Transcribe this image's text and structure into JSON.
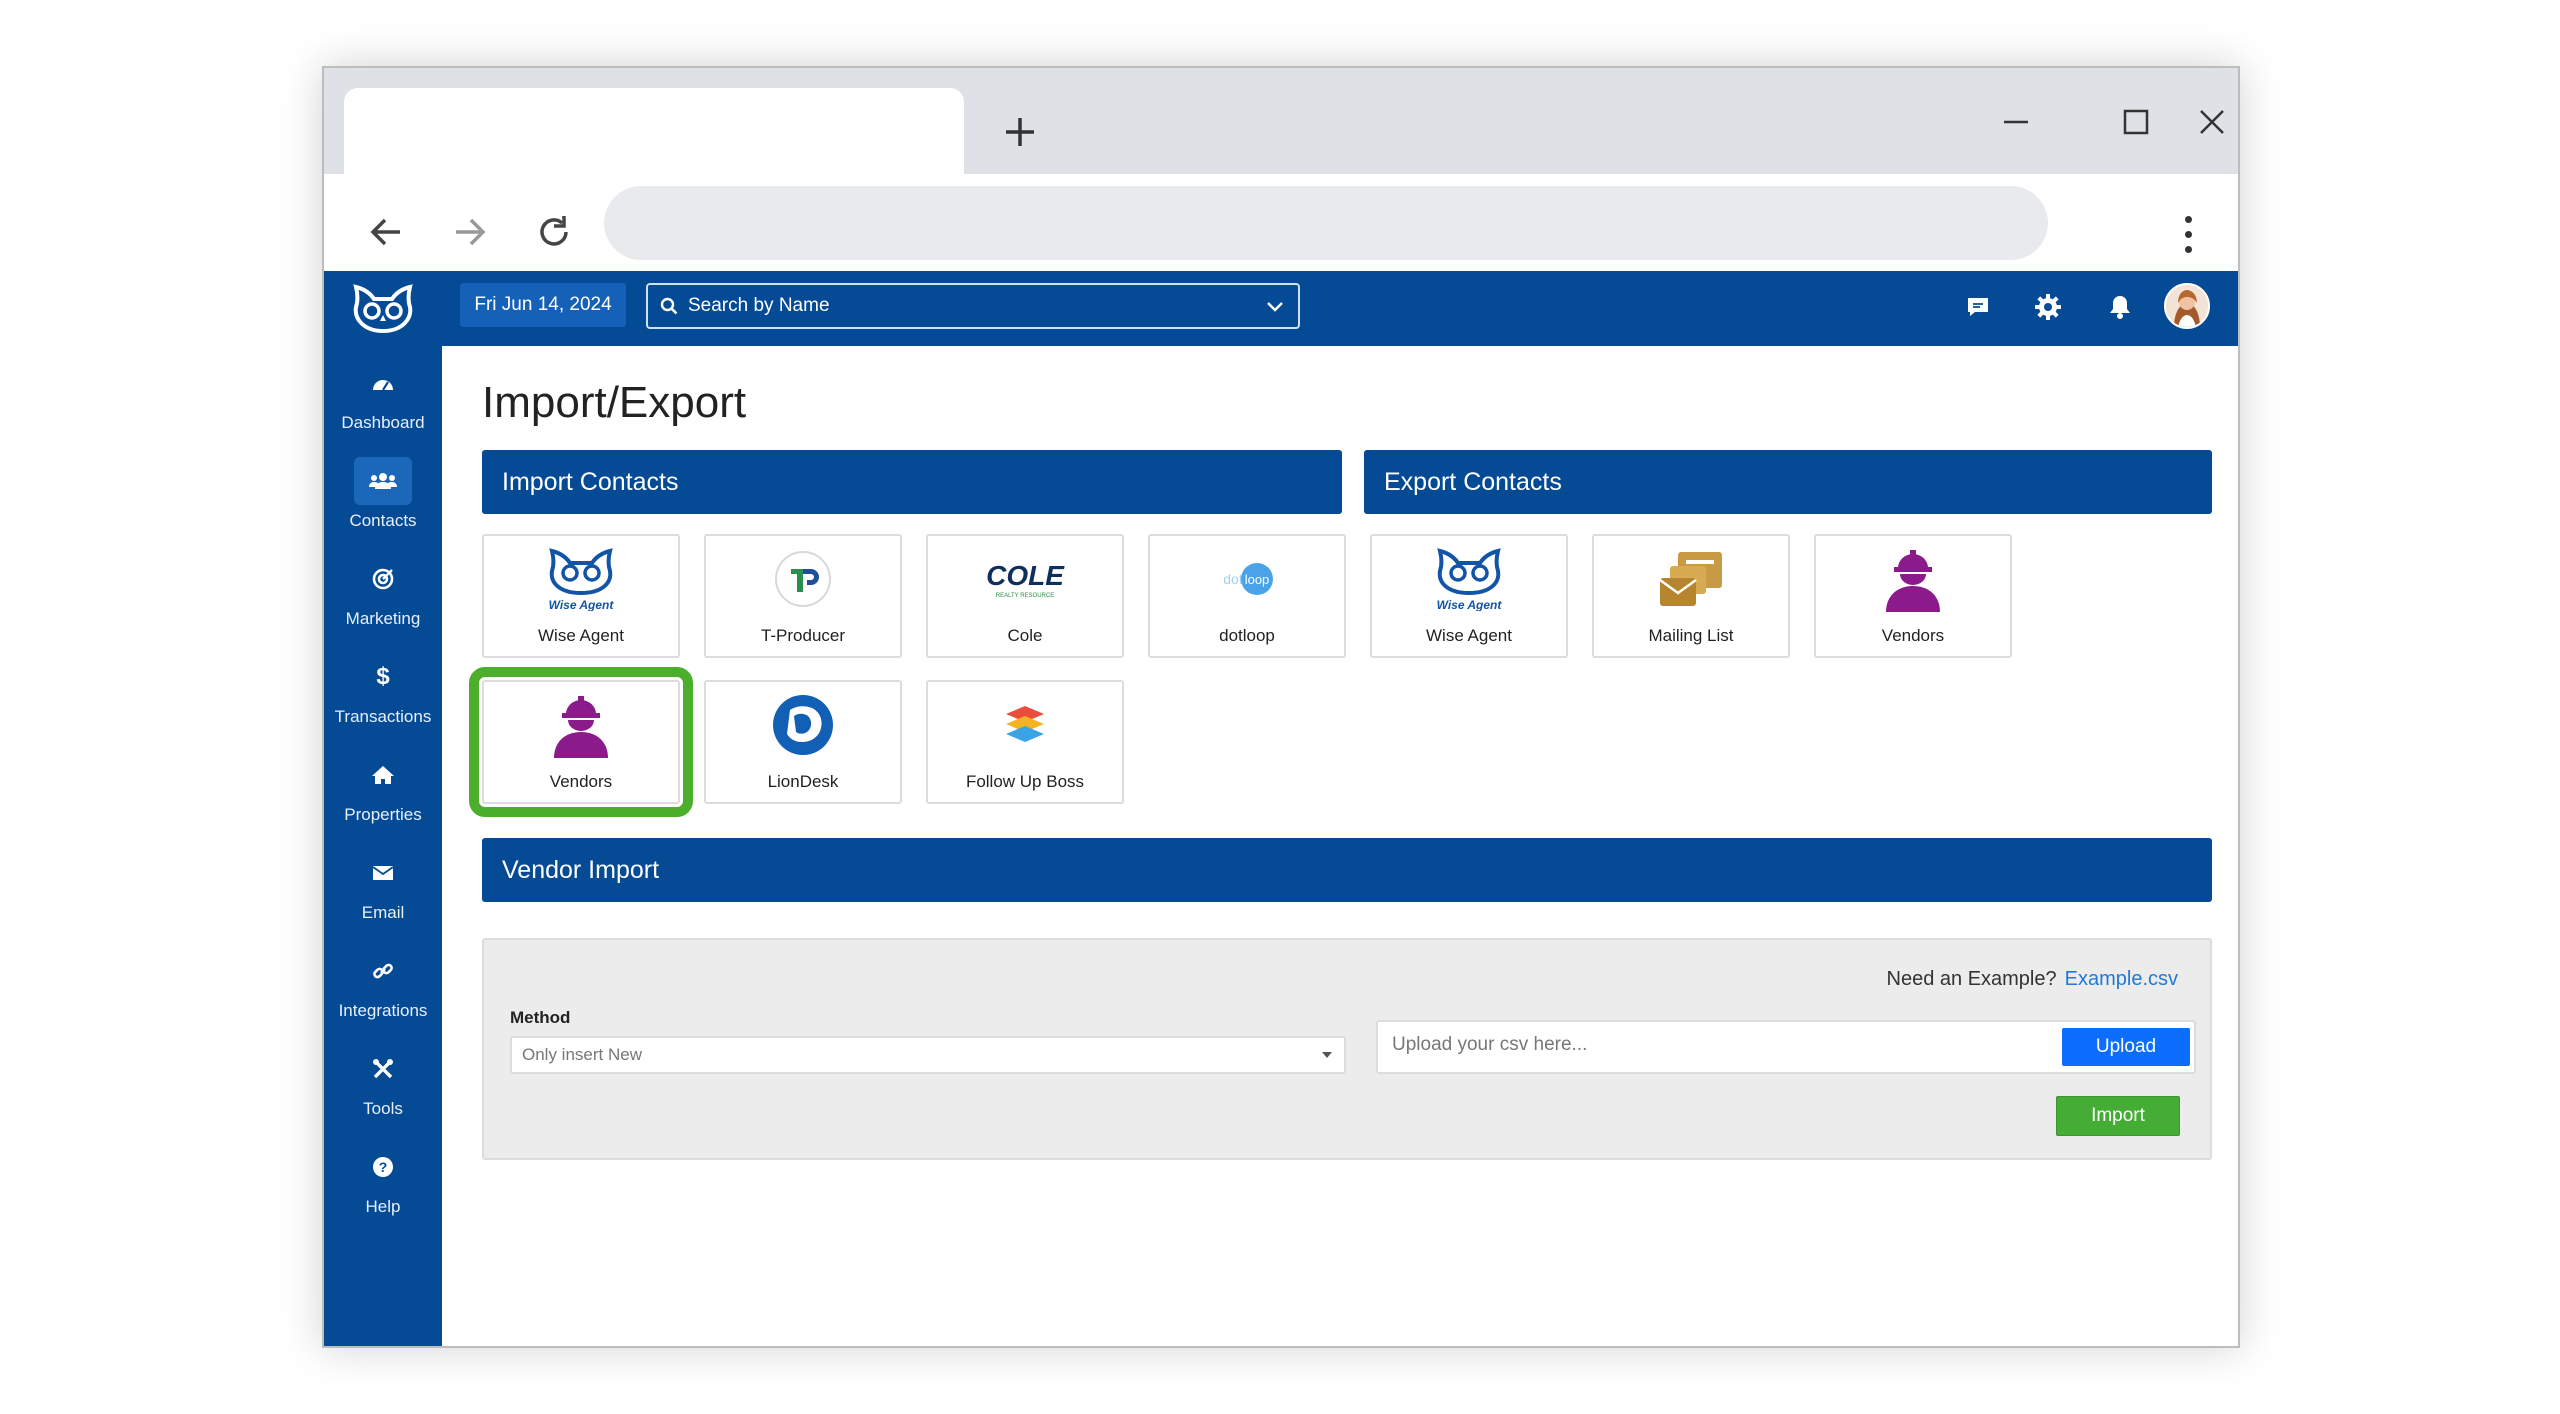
{
  "browser": {
    "new_tab_icon": "plus-icon",
    "window_controls": [
      "minimize-icon",
      "maximize-icon",
      "close-icon"
    ],
    "nav": [
      "back-arrow-icon",
      "forward-arrow-icon",
      "reload-icon"
    ],
    "menu_icon": "kebab-menu-icon"
  },
  "app": {
    "date": "Fri Jun 14, 2024",
    "search": {
      "placeholder": "Search by Name"
    },
    "sidebar": [
      {
        "label": "Dashboard",
        "icon": "dashboard-gauge-icon"
      },
      {
        "label": "Contacts",
        "icon": "contacts-users-icon",
        "active": true
      },
      {
        "label": "Marketing",
        "icon": "marketing-target-icon"
      },
      {
        "label": "Transactions",
        "icon": "dollar-icon"
      },
      {
        "label": "Properties",
        "icon": "home-icon"
      },
      {
        "label": "Email",
        "icon": "envelope-icon"
      },
      {
        "label": "Integrations",
        "icon": "link-icon"
      },
      {
        "label": "Tools",
        "icon": "tools-icon"
      },
      {
        "label": "Help",
        "icon": "help-circle-icon"
      }
    ],
    "top_icons": [
      "chat-icon",
      "gear-icon",
      "bell-icon",
      "user-avatar"
    ]
  },
  "page": {
    "title": "Import/Export",
    "import_header": "Import Contacts",
    "export_header": "Export Contacts",
    "import_cards": [
      {
        "label": "Wise Agent",
        "icon": "wise-agent-logo-icon"
      },
      {
        "label": "T-Producer",
        "icon": "t-producer-logo-icon"
      },
      {
        "label": "Cole",
        "icon": "cole-logo-icon"
      },
      {
        "label": "dotloop",
        "icon": "dotloop-logo-icon"
      },
      {
        "label": "Vendors",
        "icon": "vendor-worker-icon",
        "selected": true
      },
      {
        "label": "LionDesk",
        "icon": "liondesk-logo-icon"
      },
      {
        "label": "Follow Up Boss",
        "icon": "follow-up-boss-logo-icon"
      }
    ],
    "export_cards": [
      {
        "label": "Wise Agent",
        "icon": "wise-agent-logo-icon"
      },
      {
        "label": "Mailing List",
        "icon": "mailing-list-icon"
      },
      {
        "label": "Vendors",
        "icon": "vendor-worker-icon"
      }
    ],
    "vendor_import": {
      "header": "Vendor Import",
      "example_prompt": "Need an Example?",
      "example_link": "Example.csv",
      "method_label": "Method",
      "method_value": "Only insert New",
      "upload_placeholder": "Upload your csv here...",
      "upload_button": "Upload",
      "import_button": "Import"
    },
    "colors": {
      "brand_blue": "#044a94",
      "selected_outline": "#4caf2c",
      "upload_blue": "#0d6efd",
      "import_green": "#45ad35",
      "vendor_purple": "#8b1a8b"
    }
  },
  "cole_logo_text": "COLE",
  "cole_logo_subtext": "REALTY RESOURCE",
  "dotloop_logo_text_left": "dot",
  "dotloop_logo_text_right": "loop",
  "wise_agent_logo_text": "Wise Agent"
}
